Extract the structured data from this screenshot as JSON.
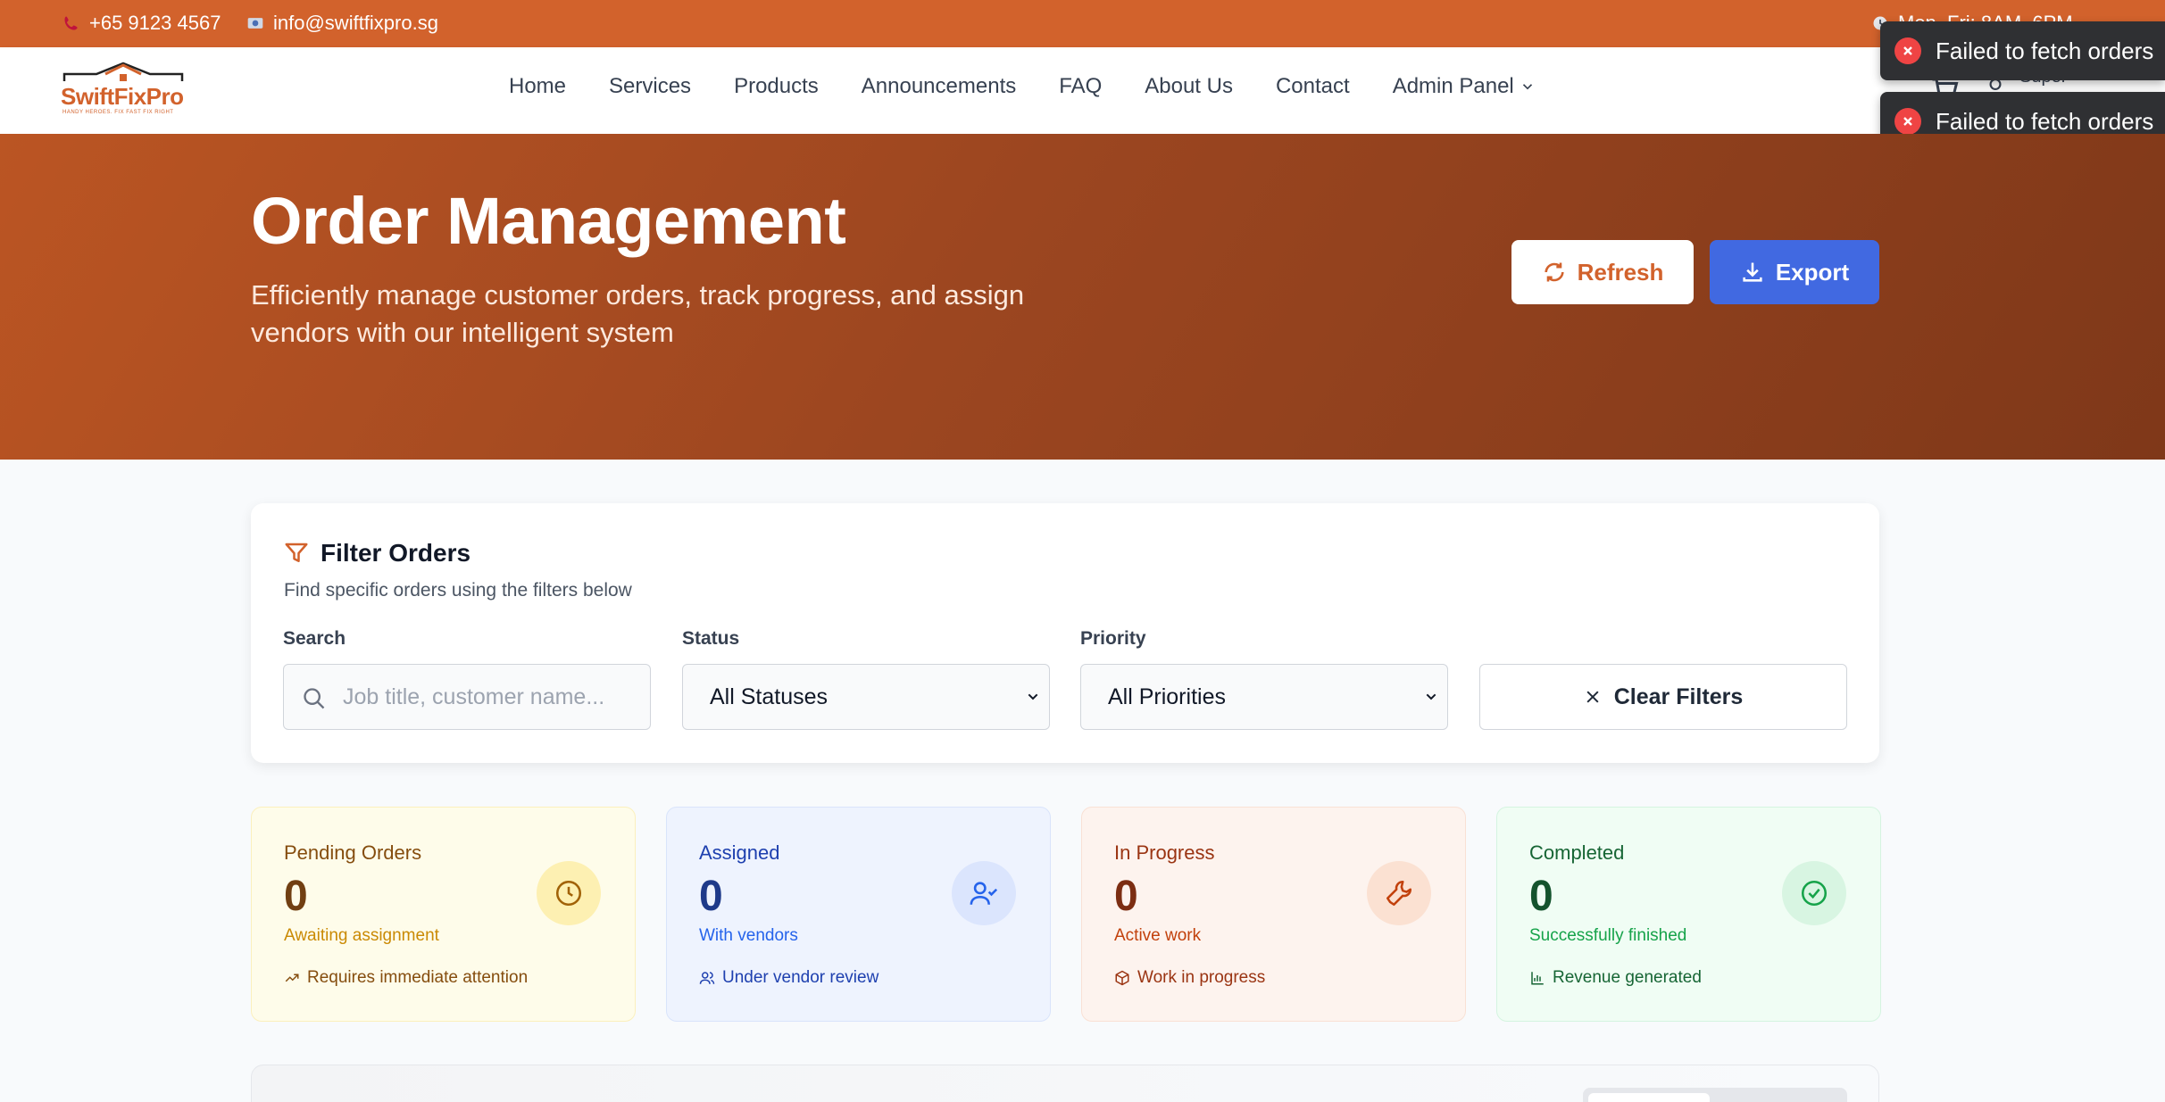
{
  "topbar": {
    "phone": "+65 9123 4567",
    "email": "info@swiftfixpro.sg",
    "hours": "Mon–Fri: 8AM–6PM"
  },
  "brand": {
    "name": "SwiftFixPro",
    "tagline": "HANDY HEROES. FIX FAST FIX RIGHT",
    "accent": "#d2622c"
  },
  "nav": {
    "items": [
      "Home",
      "Services",
      "Products",
      "Announcements",
      "FAQ",
      "About Us",
      "Contact",
      "Admin Panel"
    ]
  },
  "user": {
    "name": "Super"
  },
  "toasts": [
    "Failed to fetch orders",
    "Failed to fetch orders"
  ],
  "hero": {
    "title": "Order Management",
    "subtitle": "Efficiently manage customer orders, track progress, and assign vendors with our intelligent system",
    "refresh_label": "Refresh",
    "export_label": "Export"
  },
  "filters": {
    "title": "Filter Orders",
    "subtitle": "Find specific orders using the filters below",
    "search_label": "Search",
    "search_placeholder": "Job title, customer name...",
    "status_label": "Status",
    "status_value": "All Statuses",
    "priority_label": "Priority",
    "priority_value": "All Priorities",
    "clear_label": "Clear Filters"
  },
  "stats": [
    {
      "label": "Pending Orders",
      "value": "0",
      "desc": "Awaiting assignment",
      "foot": "Requires immediate attention",
      "icon": "clock-icon",
      "foot_icon": "trending-up-icon"
    },
    {
      "label": "Assigned",
      "value": "0",
      "desc": "With vendors",
      "foot": "Under vendor review",
      "icon": "user-check-icon",
      "foot_icon": "users-icon"
    },
    {
      "label": "In Progress",
      "value": "0",
      "desc": "Active work",
      "foot": "Work in progress",
      "icon": "wrench-icon",
      "foot_icon": "package-icon"
    },
    {
      "label": "Completed",
      "value": "0",
      "desc": "Successfully finished",
      "foot": "Revenue generated",
      "icon": "check-circle-icon",
      "foot_icon": "bar-chart-icon"
    }
  ]
}
